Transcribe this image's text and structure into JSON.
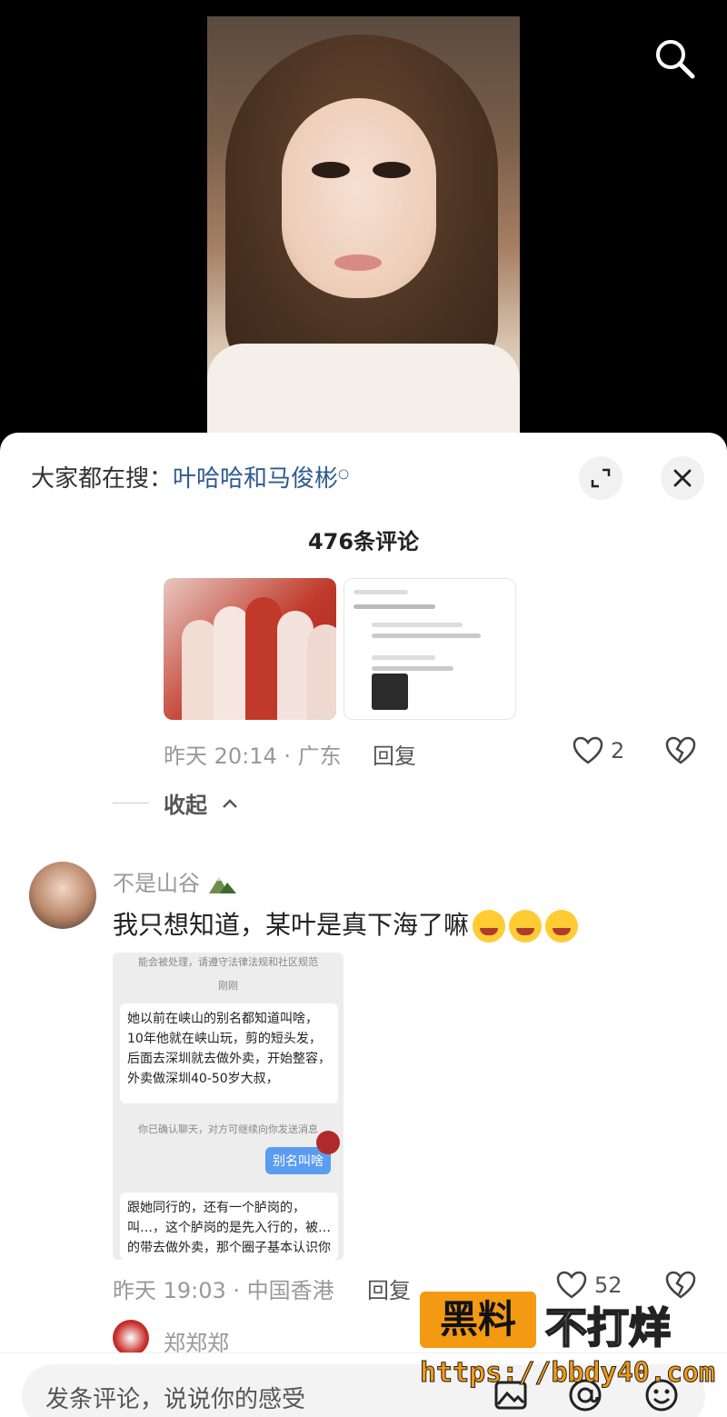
{
  "top": {
    "search_icon": "search-icon"
  },
  "sheet": {
    "hot_search_prefix": "大家都在搜：",
    "hot_search_keyword": "叶哈哈和马俊彬",
    "expand_icon": "expand-icon",
    "close_icon": "close-icon",
    "comment_count": "476条评论"
  },
  "reply": {
    "meta": "昨天 20:14 · 广东",
    "reply_label": "回复",
    "likes": "2",
    "collapse_label": "收起"
  },
  "comment": {
    "username": "不是山谷",
    "text": "我只想知道，某叶是真下海了嘛",
    "chat_screenshot": {
      "header": "能会被处理，请遵守法律法规和社区规范",
      "time": "刚刚",
      "msg1": "她以前在峡山的别名都知道叫啥，10年他就在峡山玩，剪的短头发，后面去深圳就去做外卖，开始整容，外卖做深圳40-50岁大叔，",
      "notice": "你已确认聊天，对方可继续向你发送消息",
      "my_msg": "别名叫啥",
      "msg2": "跟她同行的，还有一个胪岗的，叫…，这个胪岗的是先入行的，被…的带去做外卖，那个圈子基本认识你被擦的这个"
    },
    "meta": "昨天 19:03 · 中国香港",
    "reply_label": "回复",
    "likes": "52"
  },
  "next_comment": {
    "username": "郑郑郑"
  },
  "bottom": {
    "placeholder": "发条评论，说说你的感受",
    "icons": [
      "image-icon",
      "at-icon",
      "emoji-icon"
    ]
  },
  "watermark": {
    "badge": "黑料",
    "text": "不打烊",
    "url": "https://bbdy40.com"
  }
}
